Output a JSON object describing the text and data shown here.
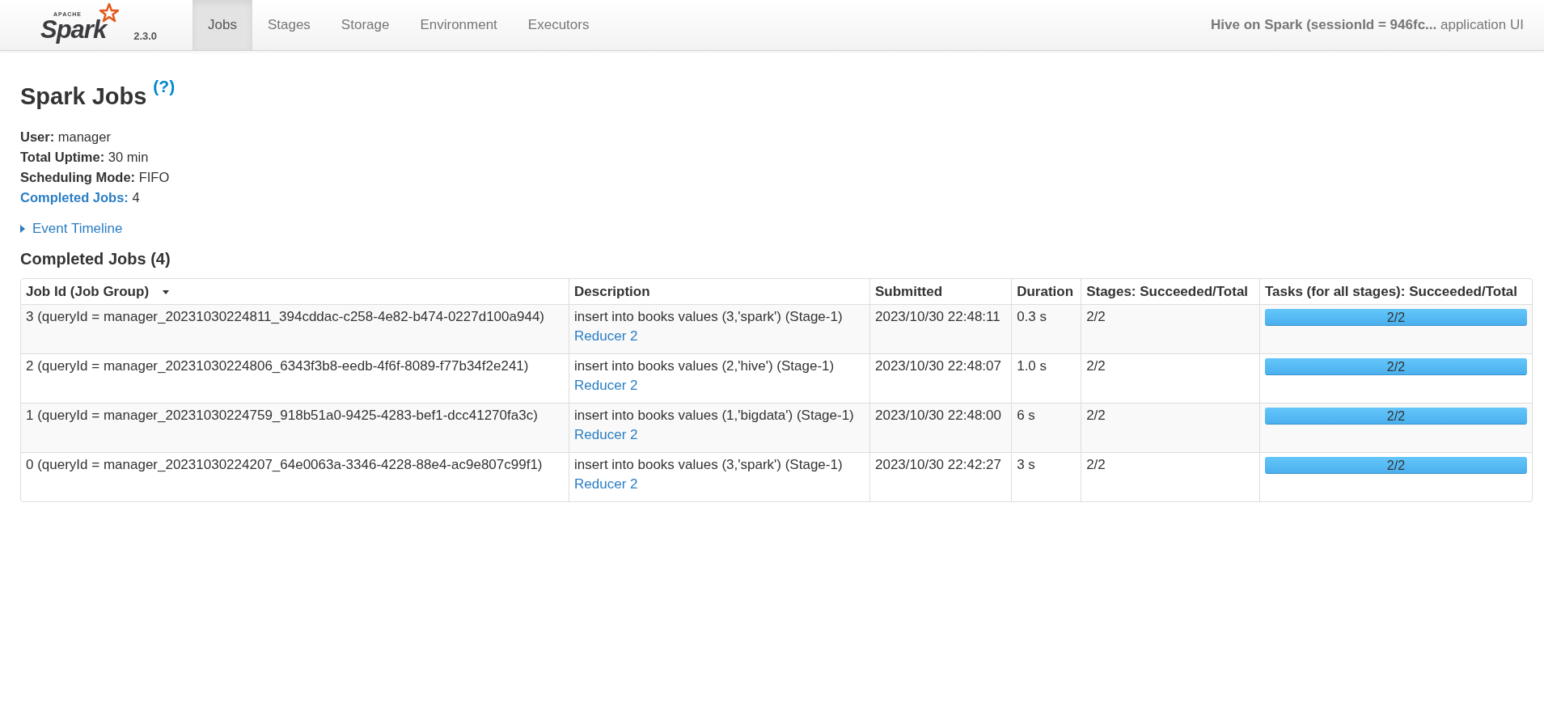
{
  "navbar": {
    "logo": {
      "small": "APACHE",
      "name": "Spark"
    },
    "version": "2.3.0",
    "tabs": [
      {
        "label": "Jobs",
        "selected": true
      },
      {
        "label": "Stages",
        "selected": false
      },
      {
        "label": "Storage",
        "selected": false
      },
      {
        "label": "Environment",
        "selected": false
      },
      {
        "label": "Executors",
        "selected": false
      }
    ],
    "app_title": "Hive on Spark (sessionId = 946fc...",
    "app_suffix": "application UI"
  },
  "page": {
    "title": "Spark Jobs",
    "help": "(?)",
    "summary": [
      {
        "label": "User:",
        "value": "manager",
        "link": false
      },
      {
        "label": "Total Uptime:",
        "value": "30 min",
        "link": false
      },
      {
        "label": "Scheduling Mode:",
        "value": "FIFO",
        "link": false
      },
      {
        "label": "Completed Jobs:",
        "value": "4",
        "link": true
      }
    ],
    "timeline": {
      "label": "Event Timeline",
      "expanded": false
    },
    "section_title": "Completed Jobs (4)"
  },
  "table": {
    "columns": [
      "Job Id (Job Group)",
      "Description",
      "Submitted",
      "Duration",
      "Stages: Succeeded/Total",
      "Tasks (for all stages): Succeeded/Total"
    ],
    "rows": [
      {
        "job": "3 (queryId = manager_20231030224811_394cddac-c258-4e82-b474-0227d100a944)",
        "description": "insert into books values (3,'spark') (Stage-1)",
        "link": "Reducer 2",
        "submitted": "2023/10/30 22:48:11",
        "duration": "0.3 s",
        "stages": "2/2",
        "tasks": "2/2",
        "level": 1
      },
      {
        "job": "2 (queryId = manager_20231030224806_6343f3b8-eedb-4f6f-8089-f77b34f2e241)",
        "description": "insert into books values (2,'hive') (Stage-1)",
        "link": "Reducer 2",
        "submitted": "2023/10/30 22:48:07",
        "duration": "1.0 s",
        "stages": "2/2",
        "tasks": "2/2",
        "level": 1
      },
      {
        "job": "1 (queryId = manager_20231030224759_918b51a0-9425-4283-bef1-dcc41270fa3c)",
        "description": "insert into books values (1,'bigdata') (Stage-1)",
        "link": "Reducer 2",
        "submitted": "2023/10/30 22:48:00",
        "duration": "6 s",
        "stages": "2/2",
        "tasks": "2/2",
        "level": 1
      },
      {
        "job": "0 (queryId = manager_20231030224207_64e0063a-3346-4228-88e4-ac9e807c99f1)",
        "description": "insert into books values (3,'spark') (Stage-1)",
        "link": "Reducer 2",
        "submitted": "2023/10/30 22:42:27",
        "duration": "3 s",
        "stages": "2/2",
        "tasks": "2/2",
        "level": 1
      }
    ]
  }
}
